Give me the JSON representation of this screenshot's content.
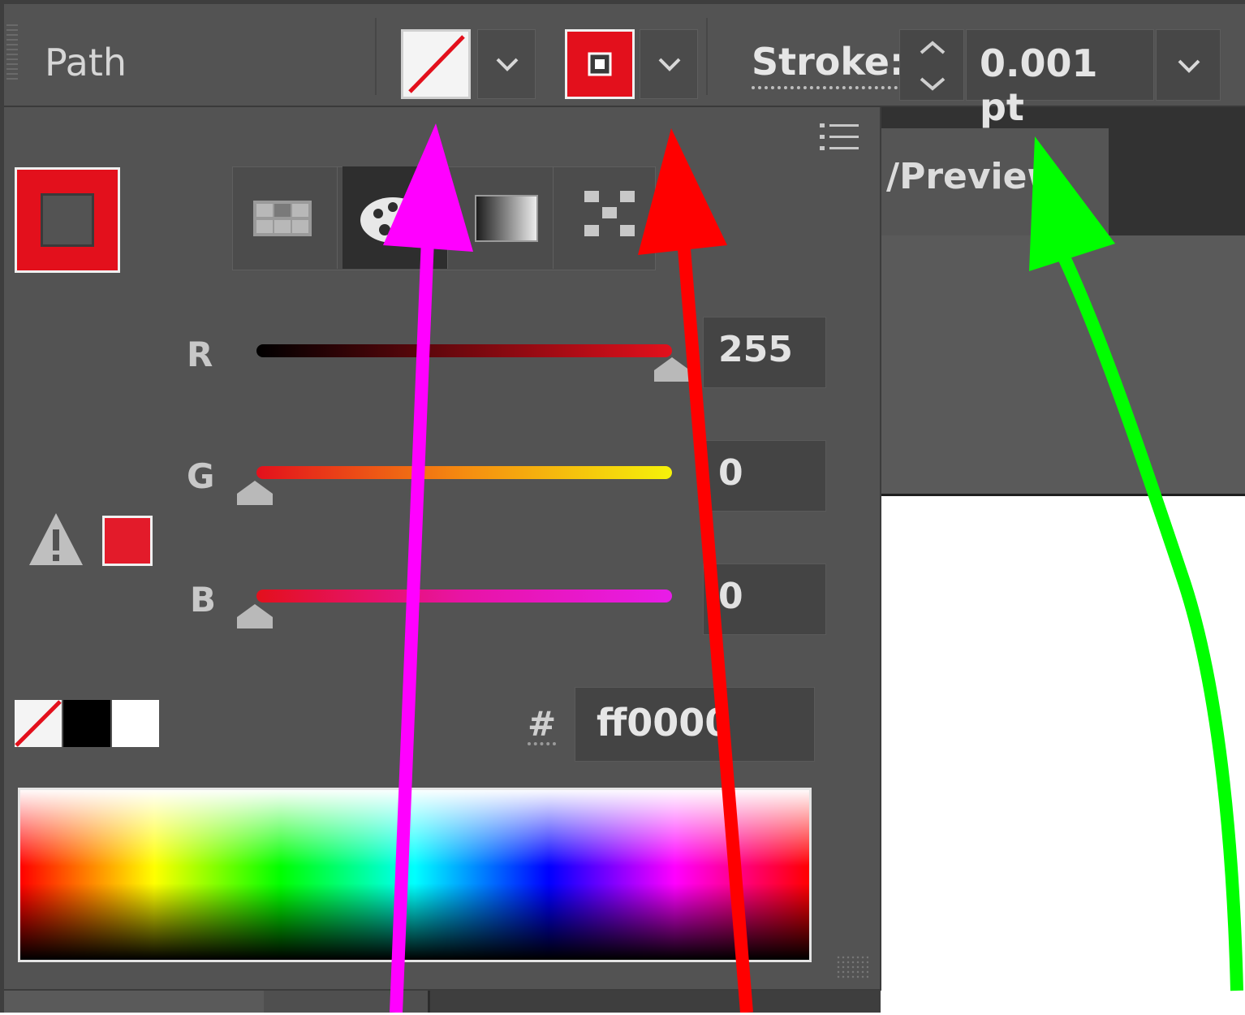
{
  "control_bar": {
    "selection_label": "Path",
    "stroke_label": "Stroke:",
    "stroke_weight": "0.001 pt",
    "fill_swatch": "none",
    "stroke_swatch_color": "#ff0000"
  },
  "document": {
    "tab_title": "/Preview"
  },
  "color_panel": {
    "channels": [
      {
        "label": "R",
        "value": "255"
      },
      {
        "label": "G",
        "value": "0"
      },
      {
        "label": "B",
        "value": "0"
      }
    ],
    "hash_label": "#",
    "hex_value": "ff0000",
    "stroke_color": "#ff0000",
    "mode_tabs": [
      "swatches",
      "color-palette",
      "gradient",
      "pattern"
    ],
    "active_mode": "color-palette",
    "quick_swatches": [
      "none",
      "black",
      "white"
    ]
  },
  "annotations": {
    "arrow_colors": [
      "#ff00ff",
      "#ff0000",
      "#00ff00"
    ]
  }
}
